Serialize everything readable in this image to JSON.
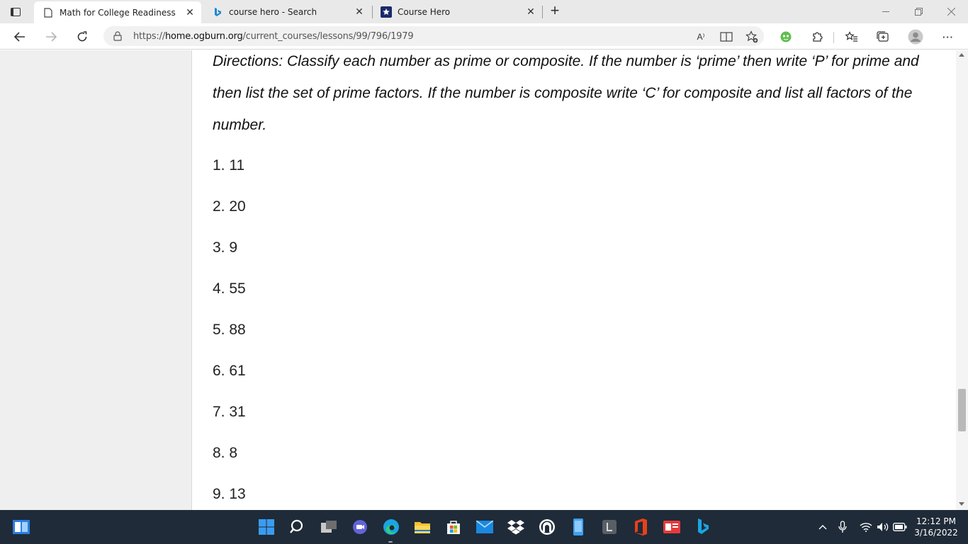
{
  "browser": {
    "tabs": [
      {
        "title": "Math for College Readiness",
        "favicon": "page-icon",
        "active": true
      },
      {
        "title": "course hero - Search",
        "favicon": "bing-icon",
        "active": false
      },
      {
        "title": "Course Hero",
        "favicon": "course-hero-star-icon",
        "active": false
      }
    ],
    "new_tab_glyph": "+",
    "close_glyph": "✕",
    "address": {
      "prefix": "https://",
      "domain": "home.ogburn.org",
      "path": "/current_courses/lessons/99/796/1979"
    },
    "read_aloud_label": "A⁾",
    "more_label": "···"
  },
  "page": {
    "directions": "Directions: Classify each number as prime or composite. If the number is ‘prime’ then write ‘P’ for prime and then list the set of prime factors. If the number is composite write ‘C’ for composite and list all factors of the number.",
    "questions": [
      "1. 11",
      "2. 20",
      "3. 9",
      "4. 55",
      "5. 88",
      "6. 61",
      "7. 31",
      "8. 8",
      "9. 13"
    ]
  },
  "taskbar": {
    "time": "12:12 PM",
    "date": "3/16/2022",
    "pinned": [
      "start",
      "search",
      "task-view",
      "teams-chat",
      "edge",
      "file-explorer",
      "store",
      "mail",
      "dropbox",
      "app",
      "phone",
      "l-app",
      "office",
      "news",
      "bing"
    ]
  },
  "colors": {
    "tabstrip": "#e9e9e9",
    "taskbar": "#1f2b38",
    "accent_blue": "#0078d4"
  }
}
